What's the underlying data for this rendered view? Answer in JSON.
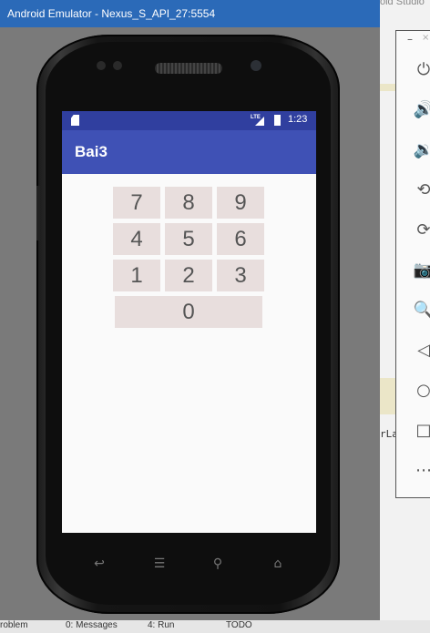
{
  "window": {
    "title": "Android Emulator - Nexus_S_API_27:5554",
    "ide_title_fragment": "oid Studio",
    "code_fragment": "rLa"
  },
  "status_strip": {
    "items": [
      "roblem",
      "0: Messages",
      "4: Run",
      "TODO"
    ]
  },
  "emulator_toolbar": {
    "min_label": "–",
    "close_label": "×",
    "items": [
      {
        "name": "power-icon",
        "glyph": "⏻"
      },
      {
        "name": "volume-up-icon",
        "glyph": "🔊"
      },
      {
        "name": "volume-down-icon",
        "glyph": "🔉"
      },
      {
        "name": "rotate-left-icon",
        "glyph": "⟲"
      },
      {
        "name": "rotate-right-icon",
        "glyph": "⟳"
      },
      {
        "name": "camera-icon",
        "glyph": "📷"
      },
      {
        "name": "zoom-icon",
        "glyph": "🔍"
      },
      {
        "name": "back-icon",
        "glyph": "◁"
      },
      {
        "name": "home-icon",
        "glyph": "○"
      },
      {
        "name": "overview-icon",
        "glyph": "□"
      },
      {
        "name": "more-icon",
        "glyph": "⋯"
      }
    ]
  },
  "device": {
    "status_time": "1:23",
    "lte_label": "LTE",
    "app_title": "Bai3",
    "keys": {
      "row1": [
        "7",
        "8",
        "9"
      ],
      "row2": [
        "4",
        "5",
        "6"
      ],
      "row3": [
        "1",
        "2",
        "3"
      ],
      "row4": [
        "0"
      ]
    },
    "nav": {
      "back": "↩",
      "menu": "☰",
      "search": "⚲",
      "home": "⌂"
    }
  },
  "colors": {
    "status_bar": "#303f9f",
    "app_bar": "#3f51b5",
    "key_bg": "#e8dedd"
  }
}
